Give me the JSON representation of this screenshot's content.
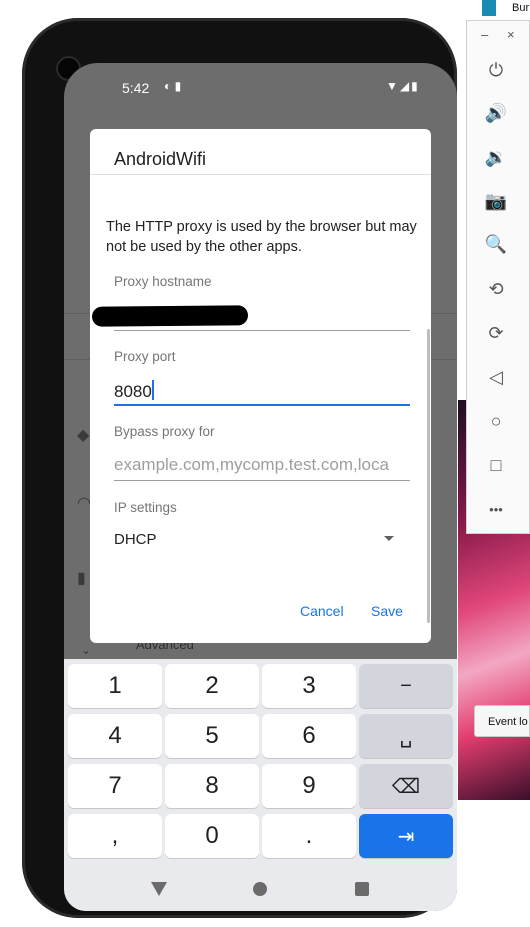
{
  "status_bar": {
    "time": "5:42",
    "left_icons": "◐ ▮",
    "right_icons": "▼◢▮"
  },
  "dialog": {
    "title": "AndroidWifi",
    "description": "The HTTP proxy is used by the browser but may not be used by the other apps.",
    "fields": {
      "hostname": {
        "label": "Proxy hostname",
        "value": ""
      },
      "port": {
        "label": "Proxy port",
        "value": "8080"
      },
      "bypass": {
        "label": "Bypass proxy for",
        "placeholder": "example.com,mycomp.test.com,loca"
      },
      "ip_settings": {
        "label": "IP settings",
        "value": "DHCP"
      }
    },
    "cancel_label": "Cancel",
    "save_label": "Save"
  },
  "background": {
    "advanced_label": "Advanced"
  },
  "keyboard": {
    "rows": [
      [
        "1",
        "2",
        "3",
        "−"
      ],
      [
        "4",
        "5",
        "6",
        "␣"
      ],
      [
        "7",
        "8",
        "9",
        "⌫"
      ],
      [
        ",",
        "0",
        ".",
        "⇥"
      ]
    ]
  },
  "emulator": {
    "title": "Bur",
    "event_log_label": "Event lo",
    "minimize": "–",
    "close": "×",
    "tools": [
      "⏻",
      "🔊",
      "🔉",
      "📷",
      "🔍",
      "⟲",
      "⟳",
      "◁",
      "○",
      "□",
      "•••"
    ]
  },
  "colors": {
    "accent": "#1a73e8",
    "dialog_bg": "#ffffff",
    "scrim": "#6d6d6d"
  }
}
